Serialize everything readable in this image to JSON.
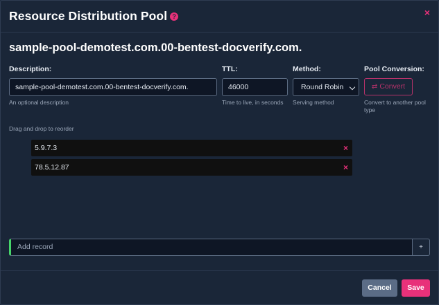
{
  "modal": {
    "title": "Resource Distribution Pool",
    "help_icon": "?",
    "close_icon": "×"
  },
  "pool": {
    "name": "sample-pool-demotest.com.00-bentest-docverify.com."
  },
  "fields": {
    "description": {
      "label": "Description:",
      "value": "sample-pool-demotest.com.00-bentest-docverify.com.",
      "help": "An optional description"
    },
    "ttl": {
      "label": "TTL:",
      "value": "46000",
      "help": "Time to live, in seconds"
    },
    "method": {
      "label": "Method:",
      "selected": "Round Robin",
      "help": "Serving method"
    },
    "conversion": {
      "label": "Pool Conversion:",
      "button_label": "Convert",
      "button_icon": "⇄",
      "help": "Convert to another pool type"
    }
  },
  "records": {
    "hint": "Drag and drop to reorder",
    "items": [
      {
        "value": "5.9.7.3"
      },
      {
        "value": "78.5.12.87"
      }
    ],
    "remove_icon": "×"
  },
  "add_record": {
    "placeholder": "Add record",
    "button_label": "+"
  },
  "footer": {
    "cancel_label": "Cancel",
    "save_label": "Save"
  },
  "colors": {
    "accent": "#e8317a",
    "background": "#1a2638",
    "success": "#46d46a",
    "secondary_button": "#5b6c86"
  }
}
